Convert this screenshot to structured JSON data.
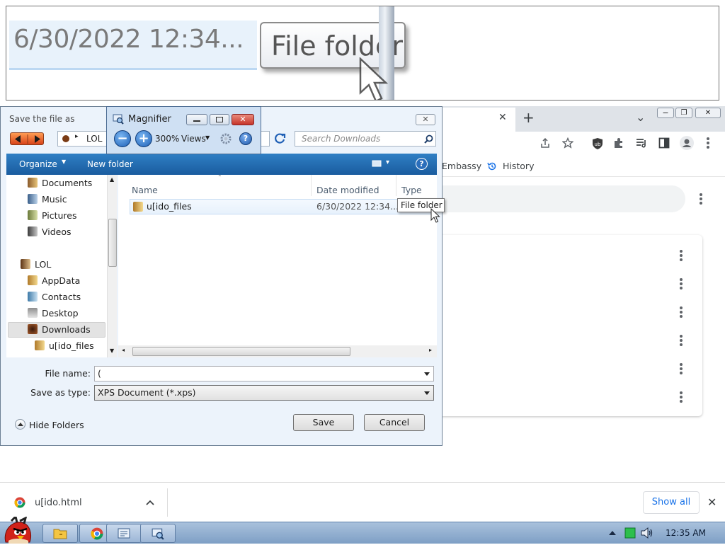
{
  "magnifier_view": {
    "date_text": "6/30/2022 12:34...",
    "tooltip_text": "File folder"
  },
  "chrome": {
    "close_tab": "✕",
    "new_tab": "+",
    "tab_search": "⌄",
    "window_controls": {
      "minimize": "−",
      "maximize": "❐",
      "close": "✕"
    },
    "bookmarks": [
      {
        "label": "Embassy"
      },
      {
        "label": "History",
        "icon": "history-icon"
      }
    ],
    "accent_color": "#1a73e8"
  },
  "dialog": {
    "title": "Save the file as",
    "close_glyph": "✕",
    "address": {
      "segments": [
        "LOL"
      ]
    },
    "search_placeholder": "Search Downloads",
    "toolbar": {
      "organize": "Organize",
      "new_folder": "New folder",
      "views_glyph": "▾",
      "help": "?"
    },
    "tree": [
      {
        "label": "Documents",
        "icon": "documents-folder-icon"
      },
      {
        "label": "Music",
        "icon": "music-folder-icon"
      },
      {
        "label": "Pictures",
        "icon": "pictures-folder-icon"
      },
      {
        "label": "Videos",
        "icon": "videos-folder-icon"
      },
      {
        "label": "LOL",
        "icon": "user-folder-icon"
      },
      {
        "label": "AppData",
        "icon": "folder-icon"
      },
      {
        "label": "Contacts",
        "icon": "contacts-folder-icon"
      },
      {
        "label": "Desktop",
        "icon": "desktop-folder-icon"
      },
      {
        "label": "Downloads",
        "icon": "downloads-folder-icon",
        "selected": true
      },
      {
        "label": "u[ido_files",
        "icon": "folder-icon"
      }
    ],
    "columns": {
      "name": "Name",
      "date": "Date modified",
      "type": "Type"
    },
    "rows": [
      {
        "name": "u[ido_files",
        "date": "6/30/2022 12:34...",
        "type": "File folder"
      }
    ],
    "tooltip": "File folder",
    "file_name_label": "File name:",
    "file_name_value": "(",
    "save_type_label": "Save as type:",
    "save_type_value": "XPS Document (*.xps)",
    "hide_folders": "Hide Folders",
    "save_button": "Save",
    "cancel_button": "Cancel"
  },
  "magnifier": {
    "title": "Magnifier",
    "zoom_out": "−",
    "zoom_in": "+",
    "zoom_level": "300%",
    "views": "Views",
    "close_glyph": "✕",
    "help": "?"
  },
  "downloads_bar": {
    "file": "u[ido.html",
    "show_all": "Show all",
    "close_glyph": "✕"
  },
  "taskbar": {
    "clock": "12:35 AM"
  }
}
